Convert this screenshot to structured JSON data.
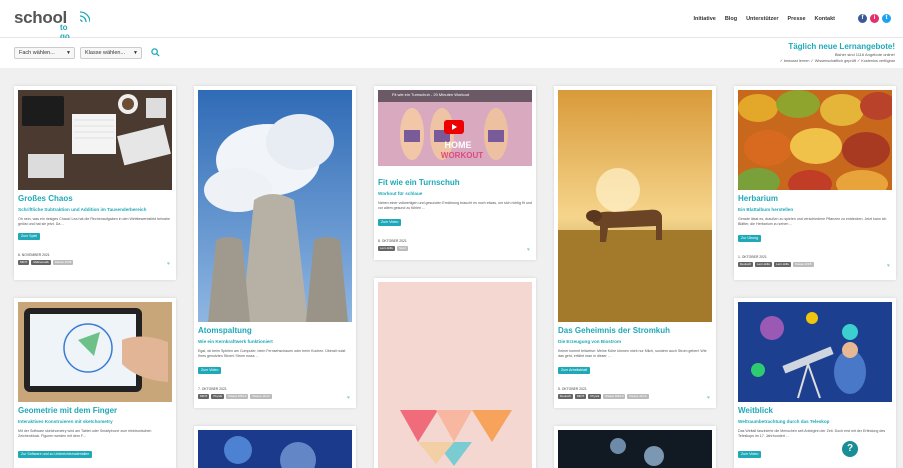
{
  "logo": {
    "main": "school",
    "sub": "to go"
  },
  "nav": [
    "Initiative",
    "Blog",
    "Unterstützer",
    "Presse",
    "Kontakt"
  ],
  "social": [
    {
      "icon": "facebook-icon",
      "glyph": "f",
      "color": "#3b5998"
    },
    {
      "icon": "instagram-icon",
      "glyph": "i",
      "color": "#e1306c"
    },
    {
      "icon": "twitter-icon",
      "glyph": "t",
      "color": "#1da1f2"
    }
  ],
  "filters": {
    "subject": "Fach wählen...",
    "grade": "Klasse wählen..."
  },
  "promo": {
    "title": "Täglich neue Lernangebote!",
    "subtitle": "Bisher sind 1116 Angebote online!",
    "checks": "✓ bewusst lernen ✓ Wissenschaftlich geprüft ✓ Kostenlos verfügbar"
  },
  "accent": "#1fa9b8",
  "cards": [
    {
      "title": "Großes Chaos",
      "subtitle": "Schriftliche Subtraktion und Addition im Tausenderbereich",
      "desc": "Oh nein, was ein riesiges Chaos! Lea hat die Rechenaufgaben in den Wettbewerbsfeld beinahe gelöst und hat sie jetzt. Da ...",
      "button": "Zum Spiel",
      "date": "6. NOVEMBER 2021",
      "tags": [
        "MINT",
        "Mathematik",
        "Klasse 3/4/5"
      ]
    },
    {
      "title": "Atomspaltung",
      "subtitle": "Wie ein Kernkraftwerk funktioniert",
      "desc": "Egal, ob beim Spielen am Computer, beim Fernsehschauen oder beim Kochen. Überall nutzt Ihres genutzten Strom! Strom muss ...",
      "button": "Zum Video",
      "date": "7. OKTOBER 2021",
      "tags": [
        "MINT",
        "Physik",
        "Klasse 8/9/10",
        "Klasse 11/12"
      ]
    },
    {
      "title": "Fit wie ein Turnschuh",
      "subtitle": "Workout für schlaue",
      "desc": "Neben einer vollwertigen und gesunden Ernährung braucht es noch etwas, um sich richtig fit und vor allem gesund zu fühlen ...",
      "button": "Zum Video",
      "date": "8. OKTOBER 2021",
      "tags": [
        "Lern-Hilfe",
        "Sport"
      ],
      "video_label": "Fit wie ein Turnschuh - 20 Minuten Workout"
    },
    {
      "title": "Das Geheimnis der Stromkuh",
      "subtitle": "Die Erzeugung von Biostrom",
      "desc": "Keiner kommt teilweise: Meine Kühe können nicht nur Milch, sondern auch Strom geben! Wie das geht, erfährt man in dieser ...",
      "button": "Zum Arbeitsblatt",
      "date": "5. OKTOBER 2021",
      "tags": [
        "Deutsch",
        "MINT",
        "Physik",
        "Klasse 8/9/10",
        "Klasse 11/12"
      ]
    },
    {
      "title": "Herbarium",
      "subtitle": "Ein Blattalbum herstellen",
      "desc": "Gerade lässt es, draußen zu spielen und verschiedene Pflanzen zu entdecken. Jetzt kann ich Blätter, die Herbarium zu sehen ...",
      "button": "Zur Übung",
      "date": "1. OKTOBER 2021",
      "tags": [
        "Deutsch",
        "Lern-Hilfe",
        "Lern-Hilfe",
        "Klasse 3/4/5"
      ]
    },
    {
      "title": "Geometrie mit dem Finger",
      "subtitle": "Interaktives Konstruieren mit sketchometry",
      "desc": "Mit der Software sketchometry wird am Tablet oder Smartphone zum elektronischen Zeichenblock. Figuren werden mit dem F...",
      "button": "Zur Software und zu Unterrichtsmaterialien"
    },
    {
      "title": "Weitblick",
      "subtitle": "Weltraumbetrachtung durch das Teleskop",
      "desc": "Das Weltall faszinierte die Menschen seit Anbeginn der Zeit. Doch erst mit der Erfindung des Teleskops im 17. Jahrhundert ...",
      "button": "Zum Video"
    }
  ],
  "help": "?"
}
